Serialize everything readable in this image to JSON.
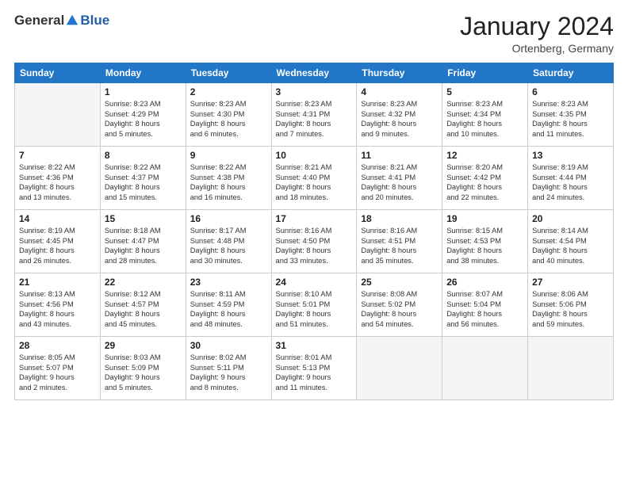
{
  "logo": {
    "general": "General",
    "blue": "Blue"
  },
  "title": "January 2024",
  "location": "Ortenberg, Germany",
  "days_header": [
    "Sunday",
    "Monday",
    "Tuesday",
    "Wednesday",
    "Thursday",
    "Friday",
    "Saturday"
  ],
  "weeks": [
    [
      {
        "day": "",
        "lines": []
      },
      {
        "day": "1",
        "lines": [
          "Sunrise: 8:23 AM",
          "Sunset: 4:29 PM",
          "Daylight: 8 hours",
          "and 5 minutes."
        ]
      },
      {
        "day": "2",
        "lines": [
          "Sunrise: 8:23 AM",
          "Sunset: 4:30 PM",
          "Daylight: 8 hours",
          "and 6 minutes."
        ]
      },
      {
        "day": "3",
        "lines": [
          "Sunrise: 8:23 AM",
          "Sunset: 4:31 PM",
          "Daylight: 8 hours",
          "and 7 minutes."
        ]
      },
      {
        "day": "4",
        "lines": [
          "Sunrise: 8:23 AM",
          "Sunset: 4:32 PM",
          "Daylight: 8 hours",
          "and 9 minutes."
        ]
      },
      {
        "day": "5",
        "lines": [
          "Sunrise: 8:23 AM",
          "Sunset: 4:34 PM",
          "Daylight: 8 hours",
          "and 10 minutes."
        ]
      },
      {
        "day": "6",
        "lines": [
          "Sunrise: 8:23 AM",
          "Sunset: 4:35 PM",
          "Daylight: 8 hours",
          "and 11 minutes."
        ]
      }
    ],
    [
      {
        "day": "7",
        "lines": [
          "Sunrise: 8:22 AM",
          "Sunset: 4:36 PM",
          "Daylight: 8 hours",
          "and 13 minutes."
        ]
      },
      {
        "day": "8",
        "lines": [
          "Sunrise: 8:22 AM",
          "Sunset: 4:37 PM",
          "Daylight: 8 hours",
          "and 15 minutes."
        ]
      },
      {
        "day": "9",
        "lines": [
          "Sunrise: 8:22 AM",
          "Sunset: 4:38 PM",
          "Daylight: 8 hours",
          "and 16 minutes."
        ]
      },
      {
        "day": "10",
        "lines": [
          "Sunrise: 8:21 AM",
          "Sunset: 4:40 PM",
          "Daylight: 8 hours",
          "and 18 minutes."
        ]
      },
      {
        "day": "11",
        "lines": [
          "Sunrise: 8:21 AM",
          "Sunset: 4:41 PM",
          "Daylight: 8 hours",
          "and 20 minutes."
        ]
      },
      {
        "day": "12",
        "lines": [
          "Sunrise: 8:20 AM",
          "Sunset: 4:42 PM",
          "Daylight: 8 hours",
          "and 22 minutes."
        ]
      },
      {
        "day": "13",
        "lines": [
          "Sunrise: 8:19 AM",
          "Sunset: 4:44 PM",
          "Daylight: 8 hours",
          "and 24 minutes."
        ]
      }
    ],
    [
      {
        "day": "14",
        "lines": [
          "Sunrise: 8:19 AM",
          "Sunset: 4:45 PM",
          "Daylight: 8 hours",
          "and 26 minutes."
        ]
      },
      {
        "day": "15",
        "lines": [
          "Sunrise: 8:18 AM",
          "Sunset: 4:47 PM",
          "Daylight: 8 hours",
          "and 28 minutes."
        ]
      },
      {
        "day": "16",
        "lines": [
          "Sunrise: 8:17 AM",
          "Sunset: 4:48 PM",
          "Daylight: 8 hours",
          "and 30 minutes."
        ]
      },
      {
        "day": "17",
        "lines": [
          "Sunrise: 8:16 AM",
          "Sunset: 4:50 PM",
          "Daylight: 8 hours",
          "and 33 minutes."
        ]
      },
      {
        "day": "18",
        "lines": [
          "Sunrise: 8:16 AM",
          "Sunset: 4:51 PM",
          "Daylight: 8 hours",
          "and 35 minutes."
        ]
      },
      {
        "day": "19",
        "lines": [
          "Sunrise: 8:15 AM",
          "Sunset: 4:53 PM",
          "Daylight: 8 hours",
          "and 38 minutes."
        ]
      },
      {
        "day": "20",
        "lines": [
          "Sunrise: 8:14 AM",
          "Sunset: 4:54 PM",
          "Daylight: 8 hours",
          "and 40 minutes."
        ]
      }
    ],
    [
      {
        "day": "21",
        "lines": [
          "Sunrise: 8:13 AM",
          "Sunset: 4:56 PM",
          "Daylight: 8 hours",
          "and 43 minutes."
        ]
      },
      {
        "day": "22",
        "lines": [
          "Sunrise: 8:12 AM",
          "Sunset: 4:57 PM",
          "Daylight: 8 hours",
          "and 45 minutes."
        ]
      },
      {
        "day": "23",
        "lines": [
          "Sunrise: 8:11 AM",
          "Sunset: 4:59 PM",
          "Daylight: 8 hours",
          "and 48 minutes."
        ]
      },
      {
        "day": "24",
        "lines": [
          "Sunrise: 8:10 AM",
          "Sunset: 5:01 PM",
          "Daylight: 8 hours",
          "and 51 minutes."
        ]
      },
      {
        "day": "25",
        "lines": [
          "Sunrise: 8:08 AM",
          "Sunset: 5:02 PM",
          "Daylight: 8 hours",
          "and 54 minutes."
        ]
      },
      {
        "day": "26",
        "lines": [
          "Sunrise: 8:07 AM",
          "Sunset: 5:04 PM",
          "Daylight: 8 hours",
          "and 56 minutes."
        ]
      },
      {
        "day": "27",
        "lines": [
          "Sunrise: 8:06 AM",
          "Sunset: 5:06 PM",
          "Daylight: 8 hours",
          "and 59 minutes."
        ]
      }
    ],
    [
      {
        "day": "28",
        "lines": [
          "Sunrise: 8:05 AM",
          "Sunset: 5:07 PM",
          "Daylight: 9 hours",
          "and 2 minutes."
        ]
      },
      {
        "day": "29",
        "lines": [
          "Sunrise: 8:03 AM",
          "Sunset: 5:09 PM",
          "Daylight: 9 hours",
          "and 5 minutes."
        ]
      },
      {
        "day": "30",
        "lines": [
          "Sunrise: 8:02 AM",
          "Sunset: 5:11 PM",
          "Daylight: 9 hours",
          "and 8 minutes."
        ]
      },
      {
        "day": "31",
        "lines": [
          "Sunrise: 8:01 AM",
          "Sunset: 5:13 PM",
          "Daylight: 9 hours",
          "and 11 minutes."
        ]
      },
      {
        "day": "",
        "lines": []
      },
      {
        "day": "",
        "lines": []
      },
      {
        "day": "",
        "lines": []
      }
    ]
  ]
}
